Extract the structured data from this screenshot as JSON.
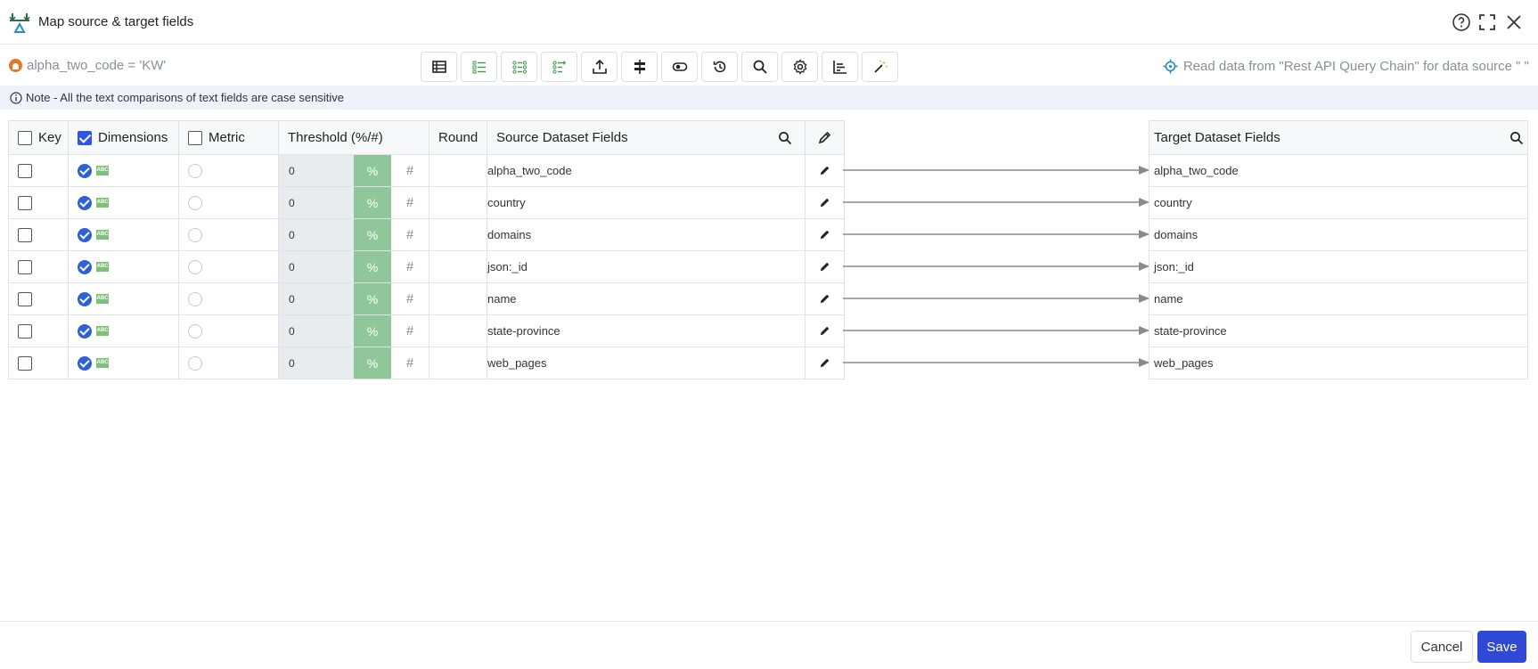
{
  "window": {
    "title": "Map source & target fields"
  },
  "toolbar": {
    "filter_text": "alpha_two_code = 'KW'",
    "read_data_text": "Read data from \"Rest API Query Chain\" for data source \" \"",
    "tools": [
      "table-icon",
      "list-icon",
      "list-check-icon",
      "list-add-icon",
      "upload-icon",
      "align-icon",
      "toggle-icon",
      "history-icon",
      "search-icon",
      "settings-icon",
      "chart-icon",
      "magic-wand-icon"
    ]
  },
  "note": {
    "text": "Note - All the text comparisons of text fields are case sensitive"
  },
  "source_table": {
    "headers": {
      "key": "Key",
      "dimensions": "Dimensions",
      "metric": "Metric",
      "threshold": "Threshold (%/#)",
      "round": "Round",
      "source_fields": "Source Dataset Fields"
    },
    "percent_label": "%",
    "hash_label": "#",
    "rows": [
      {
        "threshold": "0",
        "field": "alpha_two_code"
      },
      {
        "threshold": "0",
        "field": "country"
      },
      {
        "threshold": "0",
        "field": "domains"
      },
      {
        "threshold": "0",
        "field": "json:_id"
      },
      {
        "threshold": "0",
        "field": "name"
      },
      {
        "threshold": "0",
        "field": "state-province"
      },
      {
        "threshold": "0",
        "field": "web_pages"
      }
    ]
  },
  "target_table": {
    "header": "Target Dataset Fields",
    "rows": [
      "alpha_two_code",
      "country",
      "domains",
      "json:_id",
      "name",
      "state-province",
      "web_pages"
    ]
  },
  "footer": {
    "cancel_label": "Cancel",
    "save_label": "Save"
  },
  "colors": {
    "primary": "#2f49d6",
    "percent_toggle": "#8fc79a",
    "note_bg": "#eef2fb",
    "filter_icon": "#e07a2b"
  }
}
